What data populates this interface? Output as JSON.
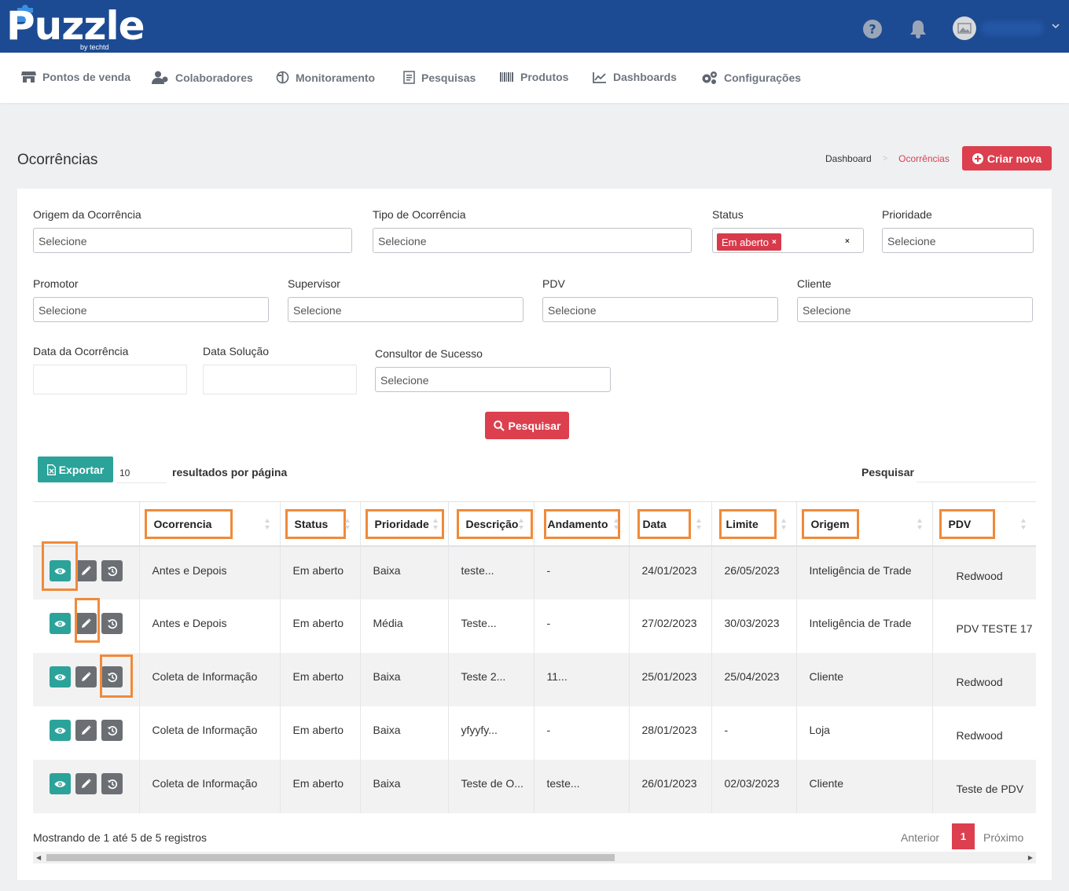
{
  "header": {
    "logo_text": "Puzzle",
    "logo_sub": "by techtd"
  },
  "nav": {
    "items": [
      {
        "label": "Pontos de venda",
        "icon": "store-icon"
      },
      {
        "label": "Colaboradores",
        "icon": "users-icon"
      },
      {
        "label": "Monitoramento",
        "icon": "monitor-icon"
      },
      {
        "label": "Pesquisas",
        "icon": "survey-icon"
      },
      {
        "label": "Produtos",
        "icon": "barcode-icon"
      },
      {
        "label": "Dashboards",
        "icon": "chart-line-icon"
      },
      {
        "label": "Configurações",
        "icon": "gears-icon"
      }
    ]
  },
  "page": {
    "title": "Ocorrências",
    "breadcrumb": {
      "home": "Dashboard",
      "current": "Ocorrências"
    },
    "create_label": "Criar nova"
  },
  "filters": {
    "origem": {
      "label": "Origem da Ocorrência",
      "value": "Selecione"
    },
    "tipo": {
      "label": "Tipo de Ocorrência",
      "value": "Selecione"
    },
    "status": {
      "label": "Status",
      "tag": "Em aberto",
      "tag_remove": "×",
      "clear": "×"
    },
    "prioridade": {
      "label": "Prioridade",
      "value": "Selecione"
    },
    "promotor": {
      "label": "Promotor",
      "value": "Selecione"
    },
    "supervisor": {
      "label": "Supervisor",
      "value": "Selecione"
    },
    "pdv": {
      "label": "PDV",
      "value": "Selecione"
    },
    "cliente": {
      "label": "Cliente",
      "value": "Selecione"
    },
    "data_ocorrencia": {
      "label": "Data da Ocorrência"
    },
    "data_solucao": {
      "label": "Data Solução"
    },
    "consultor": {
      "label": "Consultor de Sucesso",
      "value": "Selecione"
    },
    "search_label": "Pesquisar"
  },
  "toolbar": {
    "export_label": "Exportar",
    "per_page_value": "10",
    "per_page_label": "resultados por página",
    "search_label": "Pesquisar"
  },
  "table": {
    "columns": [
      "Ocorrencia",
      "Status",
      "Prioridade",
      "Descrição",
      "Andamento",
      "Data",
      "Limite",
      "Origem",
      "PDV"
    ],
    "rows": [
      [
        "Antes e Depois",
        "Em aberto",
        "Baixa",
        "teste...",
        "-",
        "24/01/2023",
        "26/05/2023",
        "Inteligência de Trade",
        "Redwood"
      ],
      [
        "Antes e Depois",
        "Em aberto",
        "Média",
        "Teste...",
        "-",
        "27/02/2023",
        "30/03/2023",
        "Inteligência de Trade",
        "PDV TESTE 17"
      ],
      [
        "Coleta de Informação",
        "Em aberto",
        "Baixa",
        "Teste 2...",
        "11...",
        "25/01/2023",
        "25/04/2023",
        "Cliente",
        "Redwood"
      ],
      [
        "Coleta de Informação",
        "Em aberto",
        "Baixa",
        "yfyyfy...",
        "-",
        "28/01/2023",
        "-",
        "Loja",
        "Redwood"
      ],
      [
        "Coleta de Informação",
        "Em aberto",
        "Baixa",
        "Teste de O...",
        "teste...",
        "26/01/2023",
        "02/03/2023",
        "Cliente",
        "Teste de PDV"
      ]
    ]
  },
  "footer": {
    "info": "Mostrando de 1 até 5 de 5 registros",
    "prev": "Anterior",
    "current_page": "1",
    "next": "Próximo"
  },
  "colors": {
    "header_bg": "#1d4b93",
    "accent_red": "#dc3f4e",
    "accent_teal": "#2ba39a",
    "highlight_orange": "#f08a3a"
  }
}
